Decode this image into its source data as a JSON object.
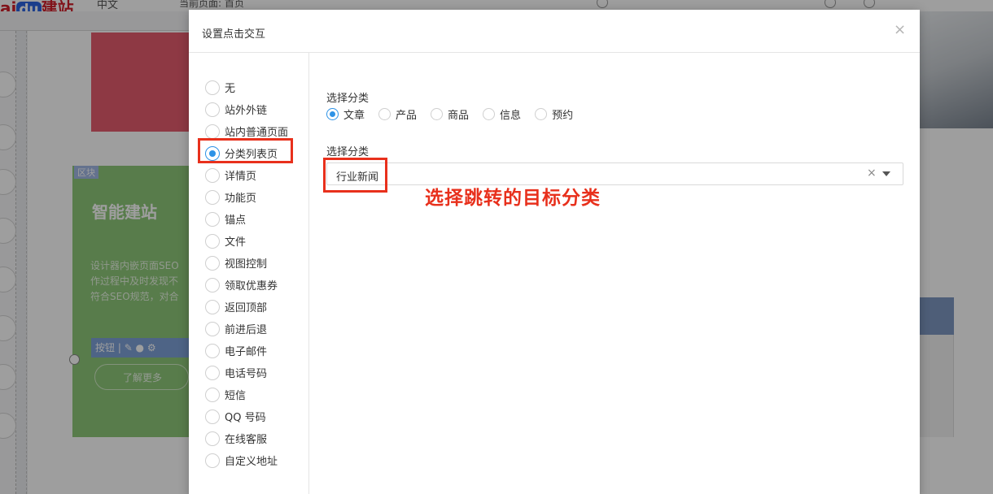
{
  "background": {
    "logo": {
      "brand": "ai",
      "du": "du",
      "suffix": "建站"
    },
    "toolbar": {
      "language": "中文",
      "current_page": "当前页面: 首页"
    },
    "canvas": {
      "block_tag": "区块",
      "block_title": "智能建站",
      "block_text": [
        "设计器内嵌页面SEO",
        "作过程中及时发现不",
        "符合SEO规范，对合"
      ],
      "button_toolbar_label": "按钮",
      "button_text": "了解更多"
    }
  },
  "modal": {
    "title": "设置点击交互",
    "close_icon": "close-icon",
    "interaction_types": [
      {
        "label": "无",
        "checked": false
      },
      {
        "label": "站外外链",
        "checked": false
      },
      {
        "label": "站内普通页面",
        "checked": false
      },
      {
        "label": "分类列表页",
        "checked": true
      },
      {
        "label": "详情页",
        "checked": false
      },
      {
        "label": "功能页",
        "checked": false
      },
      {
        "label": "锚点",
        "checked": false
      },
      {
        "label": "文件",
        "checked": false
      },
      {
        "label": "视图控制",
        "checked": false
      },
      {
        "label": "领取优惠券",
        "checked": false
      },
      {
        "label": "返回顶部",
        "checked": false
      },
      {
        "label": "前进后退",
        "checked": false
      },
      {
        "label": "电子邮件",
        "checked": false
      },
      {
        "label": "电话号码",
        "checked": false
      },
      {
        "label": "短信",
        "checked": false
      },
      {
        "label": "QQ 号码",
        "checked": false
      },
      {
        "label": "在线客服",
        "checked": false
      },
      {
        "label": "自定义地址",
        "checked": false
      }
    ],
    "category_type_label": "选择分类",
    "category_types": [
      {
        "label": "文章",
        "checked": true
      },
      {
        "label": "产品",
        "checked": false
      },
      {
        "label": "商品",
        "checked": false
      },
      {
        "label": "信息",
        "checked": false
      },
      {
        "label": "预约",
        "checked": false
      }
    ],
    "category_select_label": "选择分类",
    "category_select_value": "行业新闻",
    "clear_glyph": "×"
  },
  "annotation": {
    "callout": "选择跳转的目标分类",
    "color": "#e8301c"
  },
  "colors": {
    "accent": "#2d92e6",
    "annotation": "#e8301c"
  }
}
